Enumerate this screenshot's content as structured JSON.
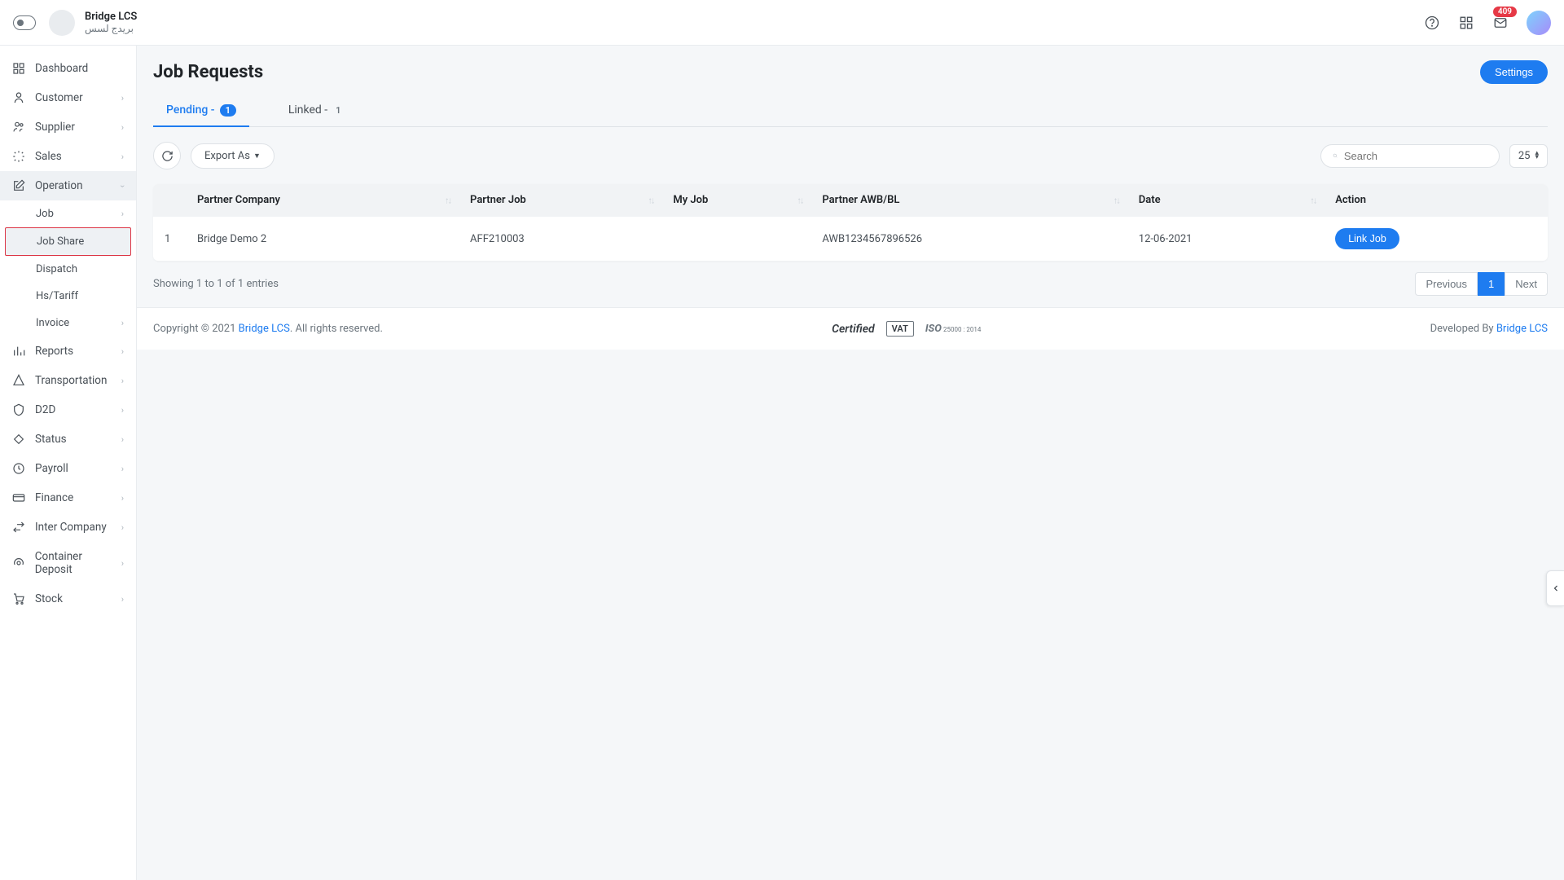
{
  "brand": {
    "name": "Bridge LCS",
    "arabic": "بريدج لسس"
  },
  "topbar": {
    "notification_count": "409"
  },
  "sidebar": {
    "items": [
      {
        "label": "Dashboard",
        "chevron": false
      },
      {
        "label": "Customer",
        "chevron": true
      },
      {
        "label": "Supplier",
        "chevron": true
      },
      {
        "label": "Sales",
        "chevron": true
      },
      {
        "label": "Operation",
        "chevron": true,
        "expanded": true
      },
      {
        "label": "Reports",
        "chevron": true
      },
      {
        "label": "Transportation",
        "chevron": true
      },
      {
        "label": "D2D",
        "chevron": true
      },
      {
        "label": "Status",
        "chevron": true
      },
      {
        "label": "Payroll",
        "chevron": true
      },
      {
        "label": "Finance",
        "chevron": true
      },
      {
        "label": "Inter Company",
        "chevron": true
      },
      {
        "label": "Container Deposit",
        "chevron": true
      },
      {
        "label": "Stock",
        "chevron": true
      }
    ],
    "operation_sub": [
      {
        "label": "Job",
        "chevron": true
      },
      {
        "label": "Job Share",
        "highlight": true
      },
      {
        "label": "Dispatch"
      },
      {
        "label": "Hs/Tariff"
      },
      {
        "label": "Invoice",
        "chevron": true
      }
    ]
  },
  "page": {
    "title": "Job Requests",
    "settings_btn": "Settings"
  },
  "tabs": [
    {
      "label": "Pending -",
      "count": "1",
      "active": true
    },
    {
      "label": "Linked -",
      "count": "1",
      "active": false
    }
  ],
  "toolbar": {
    "export_label": "Export As",
    "search_placeholder": "Search",
    "page_size": "25"
  },
  "table": {
    "columns": [
      "",
      "Partner Company",
      "Partner Job",
      "My Job",
      "Partner AWB/BL",
      "Date",
      "Action"
    ],
    "rows": [
      {
        "idx": "1",
        "partner_company": "Bridge Demo 2",
        "partner_job": "AFF210003",
        "my_job": "",
        "awb": "AWB1234567896526",
        "date": "12-06-2021",
        "action": "Link Job"
      }
    ],
    "info": "Showing 1 to 1 of 1 entries"
  },
  "pagination": {
    "prev": "Previous",
    "current": "1",
    "next": "Next"
  },
  "footer": {
    "copyright_pre": "Copyright © 2021 ",
    "brand_link": "Bridge LCS",
    "copyright_post": ". All rights reserved.",
    "dev_pre": "Developed By ",
    "dev_link": "Bridge LCS",
    "cert1": "Certified",
    "cert2": "VAT",
    "cert3": "ISO",
    "cert3_sub": "25000 : 2014"
  }
}
